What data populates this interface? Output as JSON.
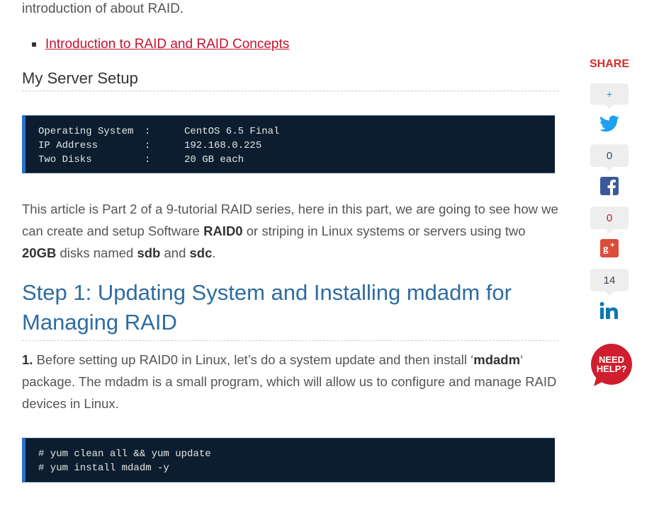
{
  "intro_tail": "introduction of about RAID.",
  "related_links": [
    "Introduction to RAID and RAID Concepts"
  ],
  "server_setup": {
    "heading": "My Server Setup",
    "rows": [
      {
        "key": "Operating System",
        "sep": ":",
        "value": "CentOS 6.5 Final"
      },
      {
        "key": "IP Address",
        "sep": ":",
        "value": "192.168.0.225"
      },
      {
        "key": "Two Disks",
        "sep": ":",
        "value": "20 GB each"
      }
    ]
  },
  "article_intro": {
    "t1": "This article is Part 2 of a 9-tutorial RAID series, here in this part, we are going to see how we can create and setup Software ",
    "b1": "RAID0",
    "t2": " or striping in Linux systems or servers using two ",
    "b2": "20GB",
    "t3": " disks named ",
    "b3": "sdb",
    "t4": " and ",
    "b4": "sdc",
    "t5": "."
  },
  "step1": {
    "heading": "Step 1: Updating System and Installing mdadm for Managing RAID",
    "num": "1.",
    "t1": " Before setting up RAID0 in Linux, let’s do a system update and then install ‘",
    "b1": "mdadm",
    "t2": "‘ package. The mdadm is a small program, which will allow us to configure and manage RAID devices in Linux.",
    "commands": [
      "# yum clean all && yum update",
      "# yum install mdadm -y"
    ]
  },
  "share": {
    "title": "SHARE",
    "plus": "+",
    "twitter_count": "0",
    "facebook_count": "0",
    "gplus_count": "14",
    "icons": [
      "twitter-icon",
      "facebook-icon",
      "google-plus-icon",
      "linkedin-icon"
    ]
  },
  "help_badge": {
    "line1": "NEED",
    "line2": "HELP?"
  },
  "colors": {
    "link": "#c4122e",
    "heading_blue": "#2d6ca2",
    "code_bg": "#0b1d2e",
    "share_red": "#d2302c",
    "twitter": "#1da1f2",
    "facebook": "#3b5998",
    "gplus": "#dd4b39",
    "linkedin": "#0a77b5"
  }
}
